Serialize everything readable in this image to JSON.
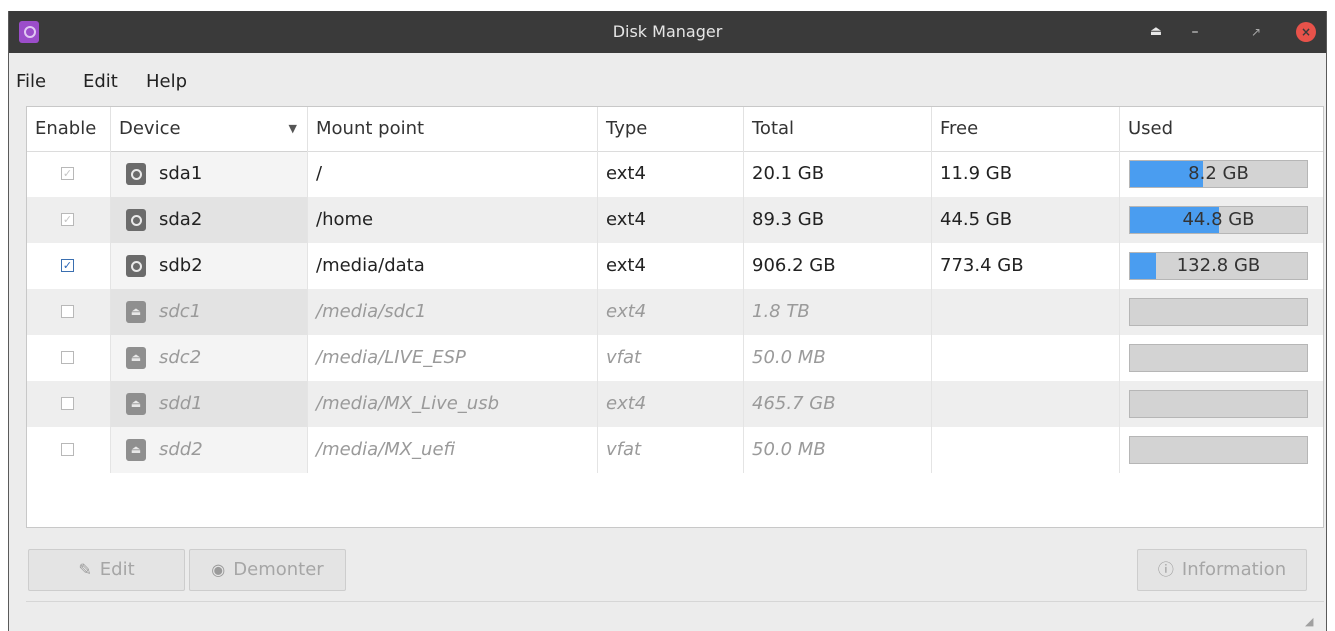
{
  "window": {
    "title": "Disk Manager"
  },
  "menu": {
    "file": "File",
    "edit": "Edit",
    "help": "Help"
  },
  "columns": {
    "enable": "Enable",
    "device": "Device",
    "mount_point": "Mount point",
    "type": "Type",
    "total": "Total",
    "free": "Free",
    "used": "Used"
  },
  "rows": [
    {
      "enabled": true,
      "editable": false,
      "device": "sda1",
      "icon": "hard-disk-icon",
      "mount": "/",
      "type": "ext4",
      "total": "20.1 GB",
      "free": "11.9 GB",
      "used": "8.2 GB",
      "used_fraction": 0.41
    },
    {
      "enabled": true,
      "editable": false,
      "device": "sda2",
      "icon": "hard-disk-icon",
      "mount": "/home",
      "type": "ext4",
      "total": "89.3 GB",
      "free": "44.5 GB",
      "used": "44.8 GB",
      "used_fraction": 0.5
    },
    {
      "enabled": true,
      "editable": true,
      "device": "sdb2",
      "icon": "hard-disk-icon",
      "mount": "/media/data",
      "type": "ext4",
      "total": "906.2 GB",
      "free": "773.4 GB",
      "used": "132.8 GB",
      "used_fraction": 0.147
    },
    {
      "enabled": false,
      "editable": true,
      "device": "sdc1",
      "icon": "eject-icon",
      "mount": "/media/sdc1",
      "type": "ext4",
      "total": "1.8 TB",
      "free": "",
      "used": "",
      "used_fraction": 0
    },
    {
      "enabled": false,
      "editable": true,
      "device": "sdc2",
      "icon": "eject-icon",
      "mount": "/media/LIVE_ESP",
      "type": "vfat",
      "total": "50.0 MB",
      "free": "",
      "used": "",
      "used_fraction": 0
    },
    {
      "enabled": false,
      "editable": true,
      "device": "sdd1",
      "icon": "eject-icon",
      "mount": "/media/MX_Live_usb",
      "type": "ext4",
      "total": "465.7 GB",
      "free": "",
      "used": "",
      "used_fraction": 0
    },
    {
      "enabled": false,
      "editable": true,
      "device": "sdd2",
      "icon": "eject-icon",
      "mount": "/media/MX_uefi",
      "type": "vfat",
      "total": "50.0 MB",
      "free": "",
      "used": "",
      "used_fraction": 0
    }
  ],
  "buttons": {
    "edit": "Edit",
    "unmount": "Demonter",
    "information": "Information"
  },
  "colors": {
    "usage_fill": "#4a9df0",
    "titlebar": "#3a3a3a",
    "close": "#e8524a"
  }
}
